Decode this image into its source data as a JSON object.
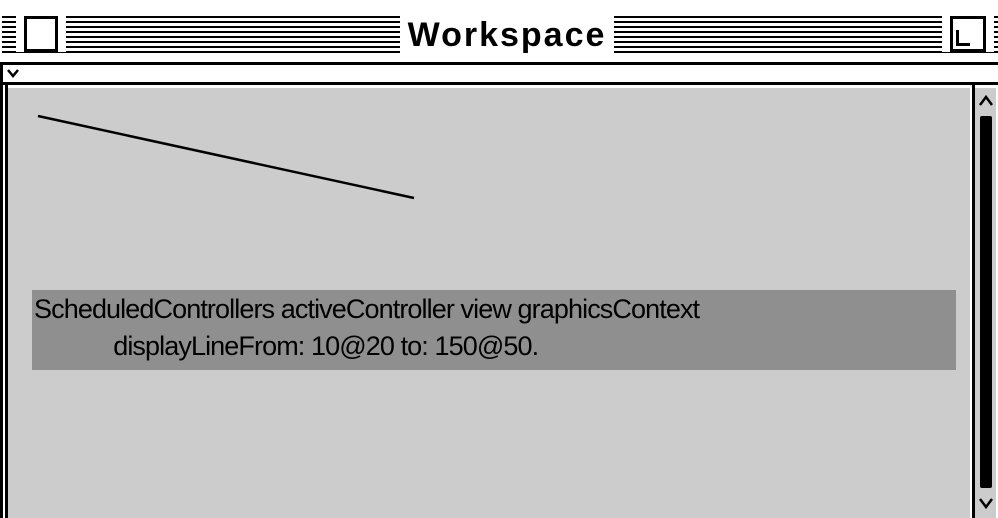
{
  "window": {
    "title": "Workspace"
  },
  "workspace": {
    "code_line_1": "ScheduledControllers activeController view graphicsContext",
    "code_line_2": "            displayLineFrom: 10@20 to: 150@50."
  },
  "icons": {
    "close": "close-box-icon",
    "zoom": "zoom-box-icon",
    "menu": "chevron-down-icon",
    "scroll_up": "arrow-up-icon",
    "scroll_down": "arrow-down-icon"
  }
}
